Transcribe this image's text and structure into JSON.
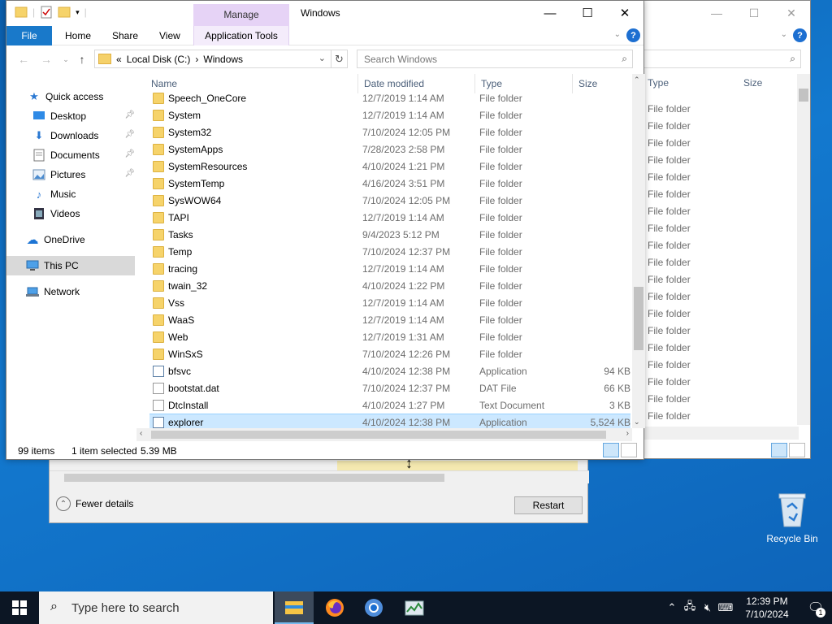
{
  "explorer": {
    "title": "Windows",
    "manage_tab": "Manage",
    "ribbon_tabs": [
      "File",
      "Home",
      "Share",
      "View",
      "Application Tools"
    ],
    "help": "?",
    "address": {
      "prefix": "«",
      "drive": "Local Disk (C:)",
      "sep": "›",
      "folder": "Windows"
    },
    "search_placeholder": "Search Windows",
    "columns": {
      "name": "Name",
      "date": "Date modified",
      "type": "Type",
      "size": "Size"
    },
    "nav": {
      "quick_access": "Quick access",
      "desktop": "Desktop",
      "downloads": "Downloads",
      "documents": "Documents",
      "pictures": "Pictures",
      "music": "Music",
      "videos": "Videos",
      "onedrive": "OneDrive",
      "this_pc": "This PC",
      "network": "Network"
    },
    "rows": [
      {
        "name": "Speech_OneCore",
        "date": "12/7/2019 1:14 AM",
        "type": "File folder",
        "size": "",
        "kind": "folder"
      },
      {
        "name": "System",
        "date": "12/7/2019 1:14 AM",
        "type": "File folder",
        "size": "",
        "kind": "folder"
      },
      {
        "name": "System32",
        "date": "7/10/2024 12:05 PM",
        "type": "File folder",
        "size": "",
        "kind": "folder"
      },
      {
        "name": "SystemApps",
        "date": "7/28/2023 2:58 PM",
        "type": "File folder",
        "size": "",
        "kind": "folder"
      },
      {
        "name": "SystemResources",
        "date": "4/10/2024 1:21 PM",
        "type": "File folder",
        "size": "",
        "kind": "folder"
      },
      {
        "name": "SystemTemp",
        "date": "4/16/2024 3:51 PM",
        "type": "File folder",
        "size": "",
        "kind": "folder"
      },
      {
        "name": "SysWOW64",
        "date": "7/10/2024 12:05 PM",
        "type": "File folder",
        "size": "",
        "kind": "folder"
      },
      {
        "name": "TAPI",
        "date": "12/7/2019 1:14 AM",
        "type": "File folder",
        "size": "",
        "kind": "folder"
      },
      {
        "name": "Tasks",
        "date": "9/4/2023 5:12 PM",
        "type": "File folder",
        "size": "",
        "kind": "folder"
      },
      {
        "name": "Temp",
        "date": "7/10/2024 12:37 PM",
        "type": "File folder",
        "size": "",
        "kind": "folder"
      },
      {
        "name": "tracing",
        "date": "12/7/2019 1:14 AM",
        "type": "File folder",
        "size": "",
        "kind": "folder"
      },
      {
        "name": "twain_32",
        "date": "4/10/2024 1:22 PM",
        "type": "File folder",
        "size": "",
        "kind": "folder"
      },
      {
        "name": "Vss",
        "date": "12/7/2019 1:14 AM",
        "type": "File folder",
        "size": "",
        "kind": "folder"
      },
      {
        "name": "WaaS",
        "date": "12/7/2019 1:14 AM",
        "type": "File folder",
        "size": "",
        "kind": "folder"
      },
      {
        "name": "Web",
        "date": "12/7/2019 1:31 AM",
        "type": "File folder",
        "size": "",
        "kind": "folder"
      },
      {
        "name": "WinSxS",
        "date": "7/10/2024 12:26 PM",
        "type": "File folder",
        "size": "",
        "kind": "folder"
      },
      {
        "name": "bfsvc",
        "date": "4/10/2024 12:38 PM",
        "type": "Application",
        "size": "94 KB",
        "kind": "app"
      },
      {
        "name": "bootstat.dat",
        "date": "7/10/2024 12:37 PM",
        "type": "DAT File",
        "size": "66 KB",
        "kind": "doc"
      },
      {
        "name": "DtcInstall",
        "date": "4/10/2024 1:27 PM",
        "type": "Text Document",
        "size": "3 KB",
        "kind": "doc"
      },
      {
        "name": "explorer",
        "date": "4/10/2024 12:38 PM",
        "type": "Application",
        "size": "5,524 KB",
        "kind": "app",
        "selected": true
      }
    ],
    "status": {
      "count": "99 items",
      "selected": "1 item selected",
      "size": "5.39 MB"
    }
  },
  "back_window": {
    "col_type": "Type",
    "col_size": "Size",
    "rows": [
      "File folder",
      "File folder",
      "File folder",
      "File folder",
      "File folder",
      "File folder",
      "File folder",
      "File folder",
      "File folder",
      "File folder",
      "File folder",
      "File folder",
      "File folder",
      "File folder",
      "File folder",
      "File folder",
      "File folder",
      "File folder",
      "File folder",
      "File folder"
    ]
  },
  "task_window": {
    "fewer_details": "Fewer details",
    "restart": "Restart"
  },
  "desktop": {
    "recycle_bin": "Recycle Bin"
  },
  "taskbar": {
    "search_placeholder": "Type here to search",
    "time": "12:39 PM",
    "date": "7/10/2024",
    "notifications": "1"
  },
  "colors": {
    "accent": "#1979ca",
    "selection": "#cce8ff",
    "manage": "#e6d3f6"
  }
}
